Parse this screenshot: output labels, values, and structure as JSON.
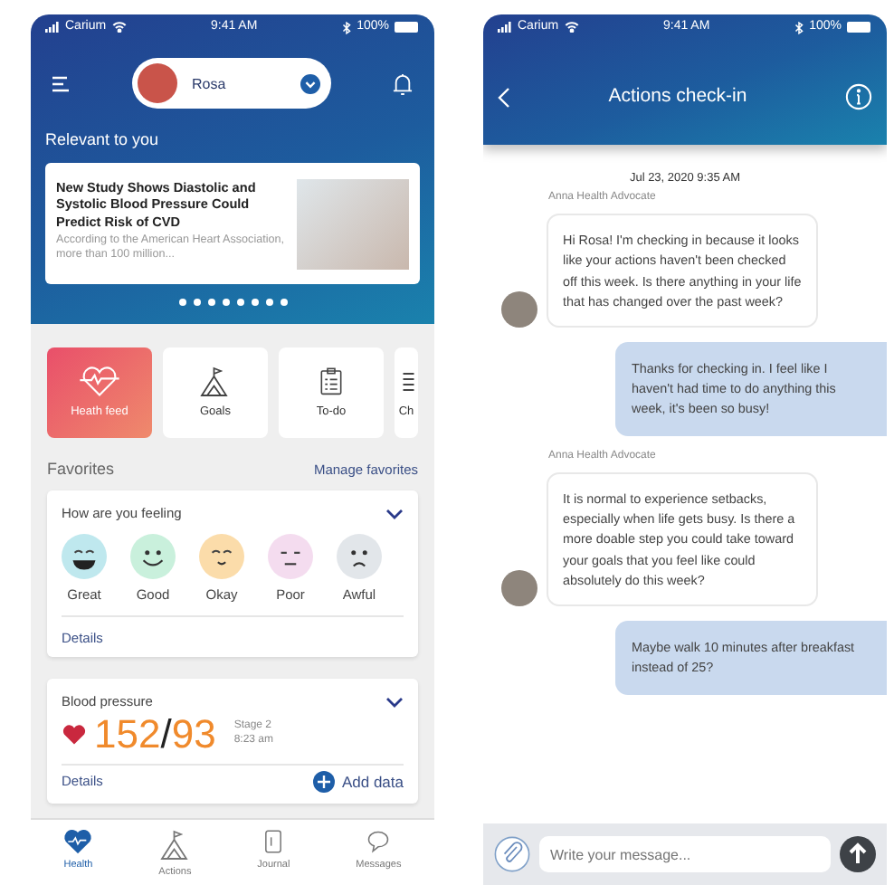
{
  "home": {
    "status_bar": {
      "carrier": "Carium",
      "time": "9:41 AM",
      "battery": "100%"
    },
    "profile": {
      "name": "Rosa"
    },
    "section_title": "Relevant to you",
    "article": {
      "title": "New Study Shows Diastolic and Systolic Blood Pressure Could Predict Risk of CVD",
      "summary": "According to the American Heart Association, more than 100 million..."
    },
    "carousel": [
      {
        "selected": false
      },
      {
        "selected": false
      },
      {
        "selected": false
      },
      {
        "selected": false
      },
      {
        "selected": false
      },
      {
        "selected": false
      },
      {
        "selected": false
      },
      {
        "selected": false
      }
    ],
    "tiles": [
      {
        "label": "Heath feed",
        "kind": "heart",
        "selected": true
      },
      {
        "label": "Goals",
        "kind": "mountain",
        "selected": false
      },
      {
        "label": "To-do",
        "kind": "clipboard",
        "selected": false
      },
      {
        "label": "Ch",
        "kind": "list",
        "selected": false
      }
    ],
    "favorites": {
      "title": "Favorites",
      "action": "Manage favorites"
    },
    "feeling_card": {
      "title": "How are you feeling",
      "link": "Details",
      "moods": [
        {
          "label": "Great",
          "kind": "great",
          "color": "#bfe8ee"
        },
        {
          "label": "Good",
          "kind": "good",
          "color": "#c9f0dc"
        },
        {
          "label": "Okay",
          "kind": "okay",
          "color": "#fbdcaa"
        },
        {
          "label": "Poor",
          "kind": "poor",
          "color": "#f4dcef"
        },
        {
          "label": "Awful",
          "kind": "awful",
          "color": "#e2e6ea"
        }
      ]
    },
    "bp_card": {
      "title": "Blood pressure",
      "systolic": "152",
      "separator": "/",
      "diastolic": "93",
      "stage": "Stage 2",
      "time": "8:23 am",
      "link": "Details",
      "action": "Add data"
    },
    "tab_bar": [
      {
        "label": "Health",
        "kind": "heart",
        "selected": true
      },
      {
        "label": "Actions",
        "kind": "mountain",
        "selected": false
      },
      {
        "label": "Journal",
        "kind": "journal",
        "selected": false
      },
      {
        "label": "Messages",
        "kind": "bubble",
        "selected": false
      }
    ]
  },
  "chat": {
    "status_bar": {
      "carrier": "Carium",
      "time": "9:41 AM",
      "battery": "100%"
    },
    "title": "Actions check-in",
    "date": "Jul 23, 2020 9:35 AM",
    "messages": [
      {
        "kind": "incoming",
        "sender": "Anna Health Advocate",
        "text": "Hi Rosa! I'm checking in because it looks like your actions haven't been checked off this week. Is there anything in your life that has changed over the past week?"
      },
      {
        "kind": "outgoing",
        "text": "Thanks for checking in. I feel like I haven't had time to do anything this week, it's been so busy!"
      },
      {
        "kind": "incoming",
        "sender": "Anna Health Advocate",
        "text": "It is normal to experience setbacks, especially when life gets busy. Is there a more doable step you could take toward your goals that you feel like could absolutely do this week?"
      },
      {
        "kind": "outgoing",
        "text": "Maybe walk 10 minutes after breakfast instead of 25?"
      }
    ],
    "composer": {
      "placeholder": "Write your message..."
    }
  }
}
